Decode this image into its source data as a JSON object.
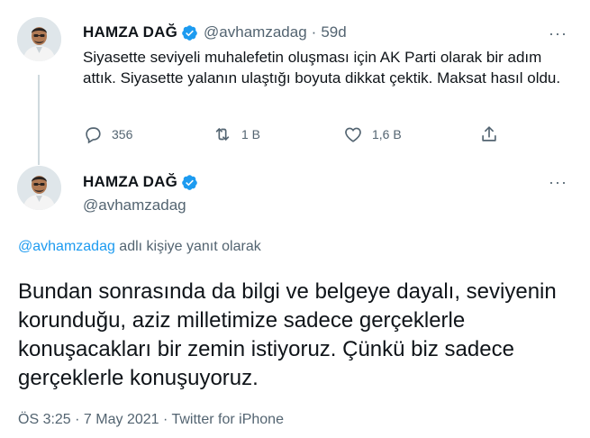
{
  "parent_tweet": {
    "author_name": "HAMZA DAĞ",
    "handle": "@avhamzadag",
    "separator": "·",
    "age": "59d",
    "more_label": "···",
    "text": "Siyasette seviyeli muhalefetin oluşması için AK Parti olarak bir adım attık. Siyasette yalanın ulaştığı boyuta dikkat çektik. Maksat hasıl oldu.",
    "actions": {
      "replies": "356",
      "retweets": "1 B",
      "likes": "1,6 B"
    }
  },
  "main_tweet": {
    "author_name": "HAMZA DAĞ",
    "handle": "@avhamzadag",
    "more_label": "···",
    "reply_mention": "@avhamzadag",
    "reply_suffix": " adlı kişiye yanıt olarak",
    "text": "Bundan sonrasında da bilgi ve belgeye dayalı, seviyenin korunduğu, aziz milletimize sadece gerçeklerle konuşacakları bir zemin istiyoruz. Çünkü biz sadece gerçeklerle konuşuyoruz.",
    "meta": "ÖS 3:25 · 7 May 2021 · Twitter for iPhone"
  },
  "colors": {
    "accent": "#1d9bf0",
    "secondary_text": "#536471",
    "primary_text": "#0f1419",
    "thread_line": "#cfd9de"
  },
  "icons": {
    "verified": "verified-badge-icon",
    "reply": "reply-bubble-icon",
    "retweet": "retweet-arrows-icon",
    "like": "heart-icon",
    "share": "share-upload-icon",
    "more": "more-dots-icon"
  }
}
